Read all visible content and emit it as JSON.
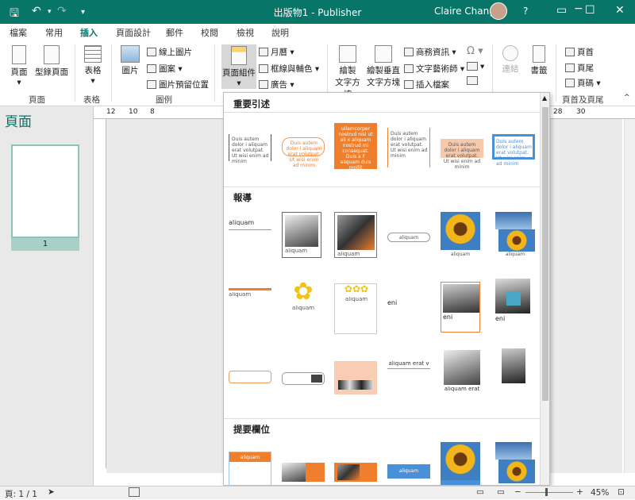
{
  "window": {
    "title": "出版物1 - Publisher",
    "user": "Claire Chang",
    "help": "?"
  },
  "tabs": [
    "檔案",
    "常用",
    "插入",
    "頁面設計",
    "郵件",
    "校閱",
    "檢視",
    "說明"
  ],
  "ribbon": {
    "pages": {
      "page": "頁面",
      "catalog": "型錄頁面",
      "group": "頁面"
    },
    "tables": {
      "table": "表格",
      "group": "表格"
    },
    "illustrations": {
      "picture": "圖片",
      "online": "線上圖片",
      "shapes": "圖案",
      "placeholder": "圖片預留位置",
      "group": "圖例"
    },
    "building_blocks": {
      "page_parts": "頁面組件",
      "calendars": "月曆",
      "borders": "框線與輔色",
      "ads": "廣告"
    },
    "text": {
      "draw_textbox": "繪製文字方塊",
      "draw_vertical_line1": "繪製垂直",
      "draw_vertical_line2": "文字方塊",
      "business_info": "商務資訊",
      "wordart": "文字藝術師",
      "insert_file": "插入檔案",
      "draw_textbox1": "繪製",
      "draw_textbox2": "文字方塊"
    },
    "links": {
      "link": "連結",
      "bookmark": "書籤"
    },
    "header_footer": {
      "header": "頁首",
      "footer": "頁尾",
      "page_number": "頁碼",
      "group": "頁首及頁尾"
    }
  },
  "left_pane": {
    "title": "頁面",
    "page_number": "1"
  },
  "ruler": {
    "h_labels": [
      "12",
      "10",
      "8",
      "28",
      "30"
    ]
  },
  "gallery": {
    "sections": [
      {
        "label": "重要引述"
      },
      {
        "label": "報導"
      },
      {
        "label": "提要欄位"
      }
    ],
    "quote_text": "Duis autem dolor i aliquam erat volutpat. Ut wisi enim ad minim",
    "orange_text": "ullamcorper nostrud nisl ut ali x aliquam nostrud mi consequat. Duis a F aliquam duis mollit",
    "story_heading": "aliquam",
    "story_heading2": "aliquam erat",
    "story_heading3": "aliquam erat v",
    "story_heading4": "eni"
  },
  "status": {
    "page": "頁: 1 / 1",
    "zoom": "45%",
    "zoom_minus": "−",
    "zoom_plus": "+"
  },
  "colors": {
    "accent": "#077568",
    "orange": "#ef7f2d",
    "blue": "#4a90d9"
  }
}
